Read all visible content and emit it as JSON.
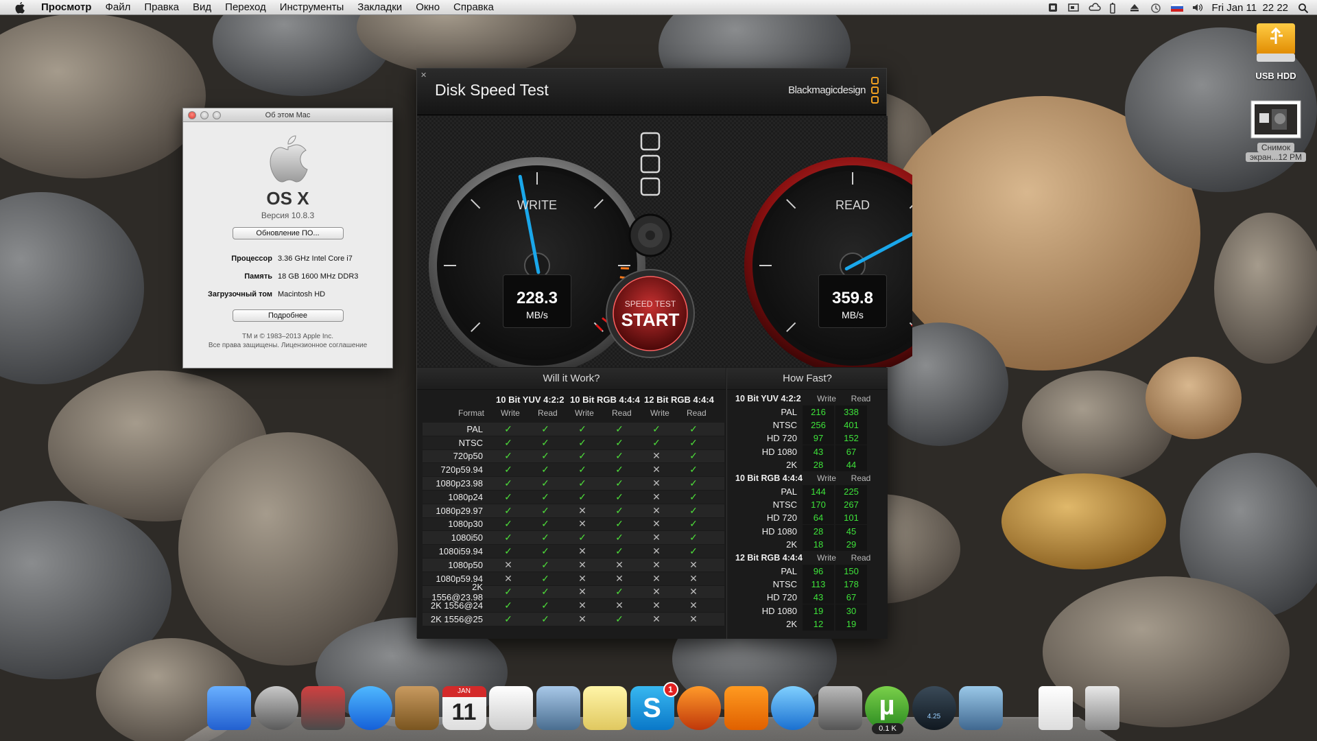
{
  "menubar": {
    "app": "Просмотр",
    "items": [
      "Файл",
      "Правка",
      "Вид",
      "Переход",
      "Инструменты",
      "Закладки",
      "Окно",
      "Справка"
    ],
    "clock": "Fri Jan 11  22 22"
  },
  "desktop": {
    "usb_label": "USB HDD",
    "shot_label_1": "Снимок",
    "shot_label_2": "экран...12 PM"
  },
  "about": {
    "title": "Об этом Mac",
    "os": "OS X",
    "version": "Версия 10.8.3",
    "update_btn": "Обновление ПО...",
    "cpu_k": "Процессор",
    "cpu_v": "3.36 GHz Intel Core i7",
    "mem_k": "Память",
    "mem_v": "18 GB 1600 MHz DDR3",
    "disk_k": "Загрузочный том",
    "disk_v": "Macintosh HD",
    "more_btn": "Подробнее",
    "foot1": "TM и © 1983–2013 Apple Inc.",
    "foot2": "Все права защищены. Лицензионное соглашение"
  },
  "dst": {
    "title": "Disk Speed Test",
    "brand": "Blackmagicdesign",
    "write_label": "WRITE",
    "read_label": "READ",
    "write_value": "228.3",
    "read_value": "359.8",
    "unit": "MB/s",
    "btn_small": "SPEED TEST",
    "btn_big": "START",
    "write_fraction": 0.46,
    "read_fraction": 0.73,
    "accent": "#1aa7ea",
    "will_title": "Will it Work?",
    "how_title": "How Fast?",
    "format_label": "Format",
    "write": "Write",
    "read": "Read",
    "groups": [
      "10 Bit YUV 4:2:2",
      "10 Bit RGB 4:4:4",
      "12 Bit RGB 4:4:4"
    ],
    "will_rows": [
      {
        "f": "PAL",
        "v": "111111"
      },
      {
        "f": "NTSC",
        "v": "111111"
      },
      {
        "f": "720p50",
        "v": "111101"
      },
      {
        "f": "720p59.94",
        "v": "111101"
      },
      {
        "f": "1080p23.98",
        "v": "111101"
      },
      {
        "f": "1080p24",
        "v": "111101"
      },
      {
        "f": "1080p29.97",
        "v": "110101"
      },
      {
        "f": "1080p30",
        "v": "110101"
      },
      {
        "f": "1080i50",
        "v": "111101"
      },
      {
        "f": "1080i59.94",
        "v": "110101"
      },
      {
        "f": "1080p50",
        "v": "010000"
      },
      {
        "f": "1080p59.94",
        "v": "010000"
      },
      {
        "f": "2K 1556@23.98",
        "v": "110100"
      },
      {
        "f": "2K 1556@24",
        "v": "110000"
      },
      {
        "f": "2K 1556@25",
        "v": "110100"
      }
    ],
    "how": [
      {
        "name": "10 Bit YUV 4:2:2",
        "rows": [
          [
            "PAL",
            "216",
            "338"
          ],
          [
            "NTSC",
            "256",
            "401"
          ],
          [
            "HD 720",
            "97",
            "152"
          ],
          [
            "HD 1080",
            "43",
            "67"
          ],
          [
            "2K",
            "28",
            "44"
          ]
        ]
      },
      {
        "name": "10 Bit RGB 4:4:4",
        "rows": [
          [
            "PAL",
            "144",
            "225"
          ],
          [
            "NTSC",
            "170",
            "267"
          ],
          [
            "HD 720",
            "64",
            "101"
          ],
          [
            "HD 1080",
            "28",
            "45"
          ],
          [
            "2K",
            "18",
            "29"
          ]
        ]
      },
      {
        "name": "12 Bit RGB 4:4:4",
        "rows": [
          [
            "PAL",
            "96",
            "150"
          ],
          [
            "NTSC",
            "113",
            "178"
          ],
          [
            "HD 720",
            "43",
            "67"
          ],
          [
            "HD 1080",
            "19",
            "30"
          ],
          [
            "2K",
            "12",
            "19"
          ]
        ]
      }
    ]
  },
  "dock": {
    "calendar_month": "JAN",
    "calendar_day": "11",
    "skype_badge": "1",
    "utorrent_badge": "0.1 K",
    "speed_gauge": "4.25",
    "items": [
      "finder-icon",
      "launchpad-icon",
      "photo-booth-icon",
      "app-store-icon",
      "address-book-icon",
      "calendar-icon",
      "reminders-icon",
      "preview-icon",
      "notes-icon",
      "skype-icon",
      "firefox-icon",
      "vlc-icon",
      "itunes-icon",
      "system-preferences-icon",
      "utorrent-icon",
      "speed-gauge-icon",
      "iphoto-icon",
      "document-icon",
      "trash-icon"
    ]
  }
}
